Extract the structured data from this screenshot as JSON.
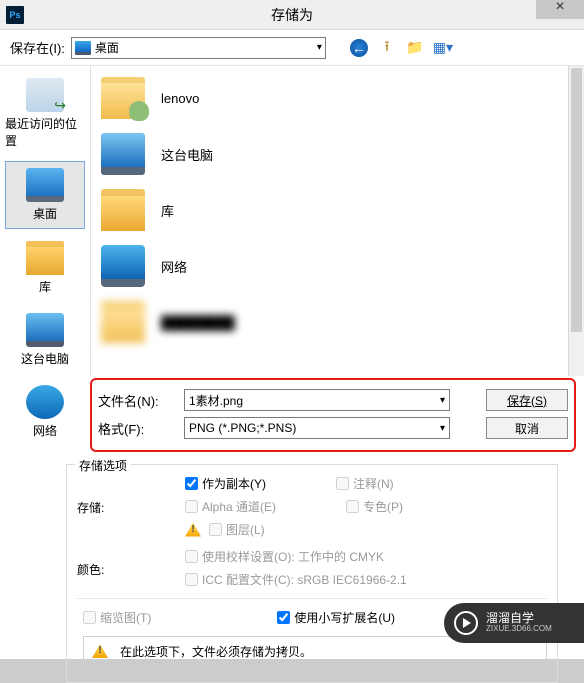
{
  "title": "存储为",
  "close": "×",
  "toprow": {
    "label": "保存在(I):",
    "location": "桌面"
  },
  "nav": {
    "recent": "最近访问的位置",
    "desktop": "桌面",
    "library": "库",
    "thispc": "这台电脑",
    "network": "网络"
  },
  "items": {
    "lenovo": "lenovo",
    "thispc": "这台电脑",
    "library": "库",
    "network": "网络",
    "hidden": "████████"
  },
  "form": {
    "filename_label": "文件名(N):",
    "filename_value": "1素材.png",
    "format_label": "格式(F):",
    "format_value": "PNG (*.PNG;*.PNS)",
    "save": "保存(S)",
    "cancel": "取消"
  },
  "opts": {
    "group": "存储选项",
    "store": "存储:",
    "copy": "作为副本(Y)",
    "note": "注释(N)",
    "alpha": "Alpha 通道(E)",
    "spot": "专色(P)",
    "layers": "图层(L)",
    "color": "颜色:",
    "proof": "使用校样设置(O): 工作中的 CMYK",
    "icc": "ICC 配置文件(C): sRGB IEC61966-2.1",
    "thumb": "缩览图(T)",
    "lowerext": "使用小写扩展名(U)",
    "msg": "在此选项下，文件必须存储为拷贝。"
  },
  "brand": {
    "name": "溜溜自学",
    "url": "ZIXUE.3D66.COM"
  }
}
